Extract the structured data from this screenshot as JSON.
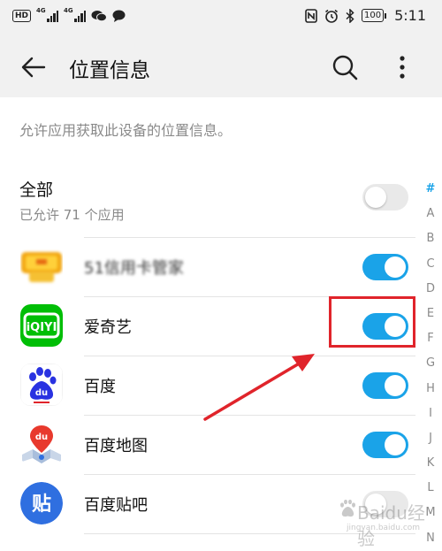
{
  "status_bar": {
    "left": {
      "hd": "HD",
      "sim1": "4G",
      "sim2": "4G"
    },
    "right": {
      "battery": "100",
      "time": "5:11"
    }
  },
  "app_bar": {
    "title": "位置信息"
  },
  "description": "允许应用获取此设备的位置信息。",
  "all": {
    "title": "全部",
    "subtitle": "已允许 71 个应用",
    "switch_on": false
  },
  "apps": [
    {
      "name": "51信用卡管家",
      "icon": "credit-card-manager-icon",
      "enabled": true,
      "blurred": true
    },
    {
      "name": "爱奇艺",
      "icon": "iqiyi-icon",
      "enabled": true,
      "blurred": false
    },
    {
      "name": "百度",
      "icon": "baidu-icon",
      "enabled": true,
      "blurred": false
    },
    {
      "name": "百度地图",
      "icon": "baidu-map-icon",
      "enabled": true,
      "blurred": false
    },
    {
      "name": "百度贴吧",
      "icon": "baidu-tieba-icon",
      "enabled": false,
      "blurred": false
    }
  ],
  "index_letters": [
    "#",
    "A",
    "B",
    "C",
    "D",
    "E",
    "F",
    "G",
    "H",
    "I",
    "J",
    "K",
    "L",
    "M",
    "N"
  ],
  "colors": {
    "accent": "#1aa3e8",
    "annotation": "#e0242b",
    "iqiyi": "#00be06",
    "baidu_blue": "#2932e1"
  },
  "watermark": {
    "text": "Baidu经验",
    "sub": "jingyan.baidu.com"
  }
}
